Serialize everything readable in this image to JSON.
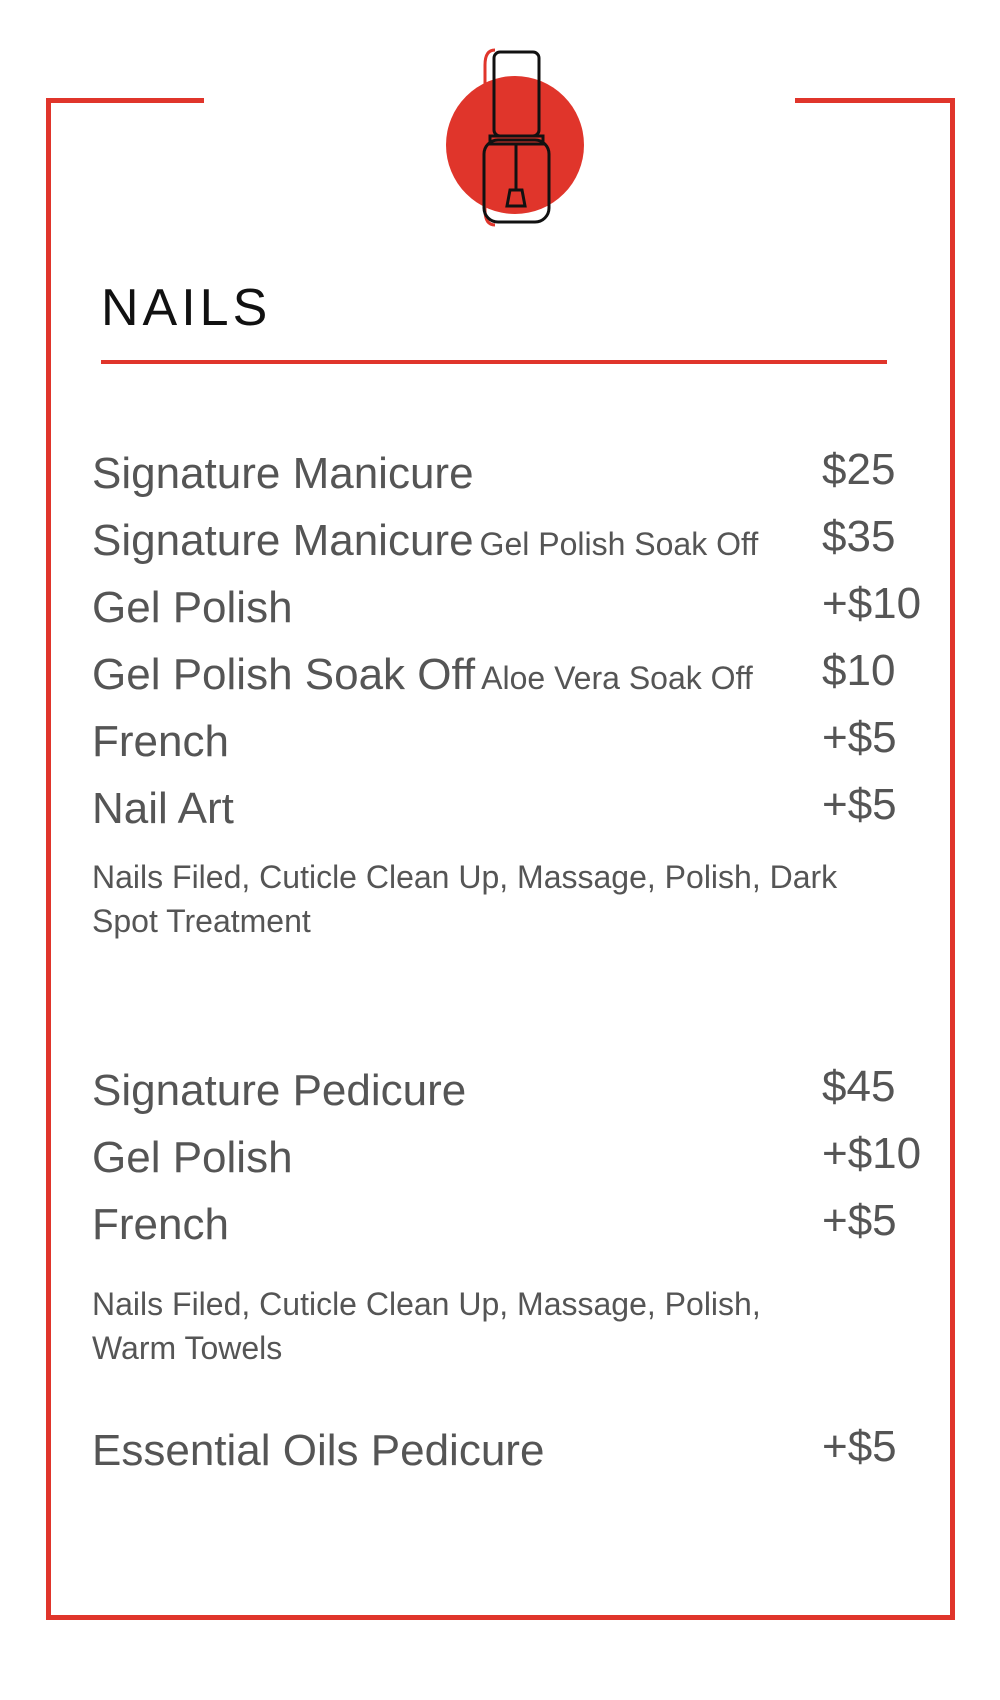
{
  "colors": {
    "accent": "#e0352b",
    "text": "#555555",
    "title": "#111111"
  },
  "icon": "nail-polish-bottle-icon",
  "section": {
    "title": "NAILS"
  },
  "manicure": {
    "items": [
      {
        "name": "Signature Manicure",
        "sub": "",
        "price": "$25"
      },
      {
        "name": "Signature Manicure",
        "sub": "Gel Polish Soak Off",
        "price": "$35"
      },
      {
        "name": "Gel Polish",
        "sub": "",
        "price": "+$10"
      },
      {
        "name": "Gel Polish Soak Off",
        "sub": "Aloe Vera Soak Off",
        "price": "$10"
      },
      {
        "name": "French",
        "sub": "",
        "price": "+$5"
      },
      {
        "name": "Nail Art",
        "sub": "",
        "price": "+$5"
      }
    ],
    "note": "Nails Filed, Cuticle Clean Up, Massage, Polish, Dark Spot Treatment"
  },
  "pedicure": {
    "items": [
      {
        "name": "Signature Pedicure",
        "sub": "",
        "price": "$45"
      },
      {
        "name": "Gel Polish",
        "sub": "",
        "price": "+$10"
      },
      {
        "name": "French",
        "sub": "",
        "price": "+$5"
      }
    ],
    "note": "Nails Filed, Cuticle Clean Up, Massage, Polish, Warm Towels"
  },
  "extra": {
    "name": "Essential Oils Pedicure",
    "price": "+$5"
  }
}
